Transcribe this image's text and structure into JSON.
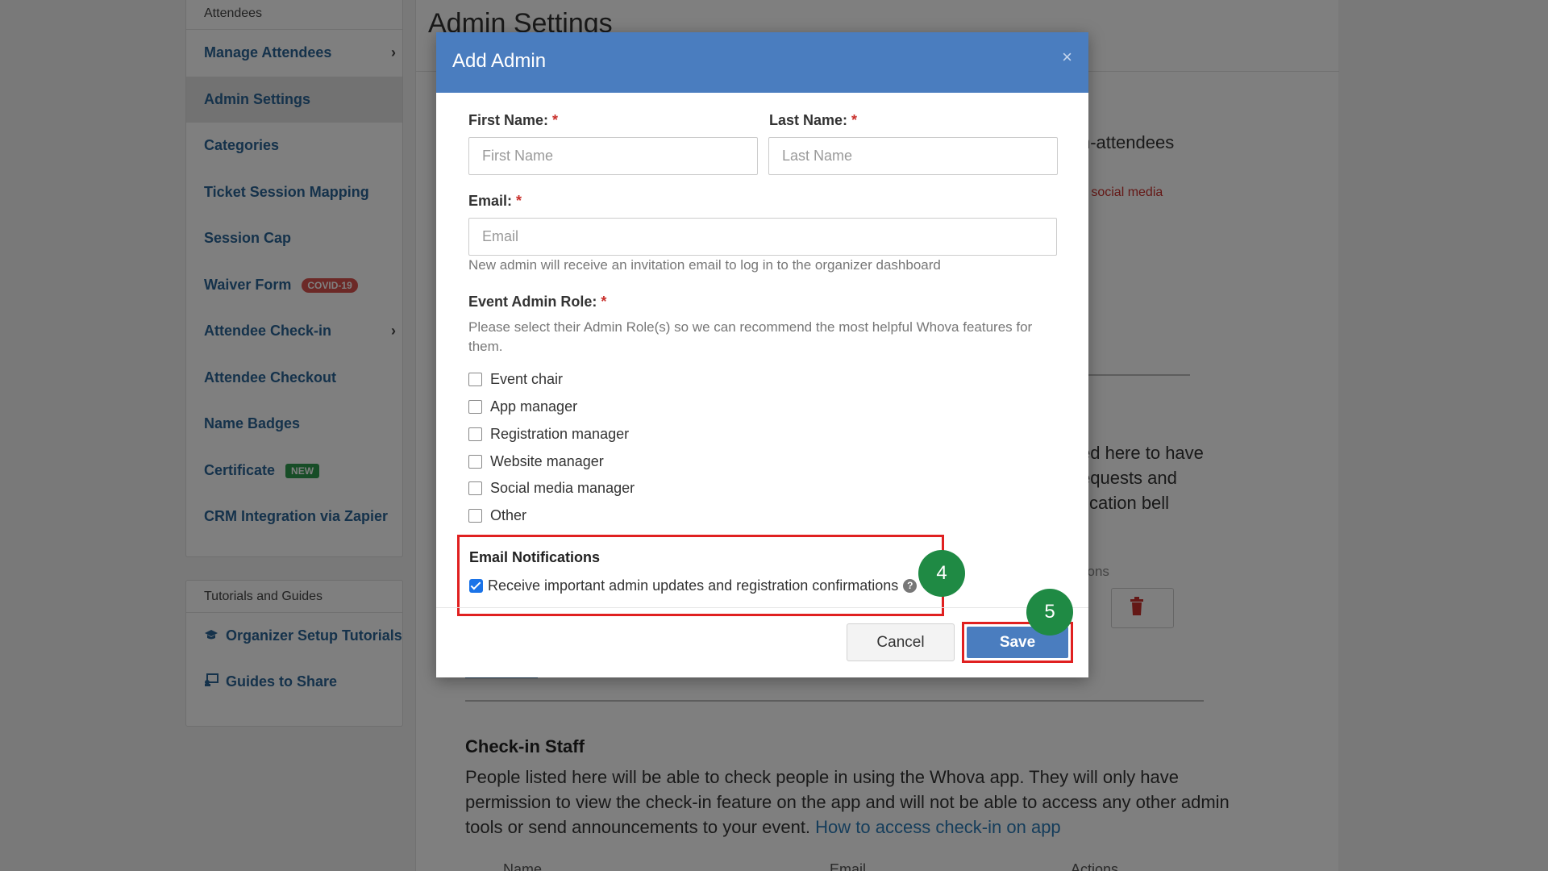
{
  "sidebar": {
    "section_heading": "Attendees",
    "items": [
      {
        "label": "Manage Attendees",
        "has_arrow": true
      },
      {
        "label": "Admin Settings",
        "active": true
      },
      {
        "label": "Categories"
      },
      {
        "label": "Ticket Session Mapping"
      },
      {
        "label": "Session Cap"
      },
      {
        "label": "Waiver Form",
        "badge": "COVID-19"
      },
      {
        "label": "Attendee Check-in",
        "has_arrow": true
      },
      {
        "label": "Attendee Checkout"
      },
      {
        "label": "Name Badges"
      },
      {
        "label": "Certificate",
        "badge": "NEW"
      },
      {
        "label": "CRM Integration via Zapier"
      }
    ],
    "tutorials": {
      "heading": "Tutorials and Guides",
      "items": [
        {
          "label": "Organizer Setup Tutorials",
          "icon": "graduation-cap-icon"
        },
        {
          "label": "Guides to Share",
          "icon": "share-guide-icon"
        }
      ]
    }
  },
  "content": {
    "page_title": "Admin Settings",
    "fragments": {
      "f1": "n-attendees",
      "f2": "n social media",
      "f3": "ed here to have",
      "f4": "equests and",
      "f5": "fication bell",
      "f6": "tions"
    },
    "checkin": {
      "title": "Check-in Staff",
      "text": "People listed here will be able to check people in using the Whova app. They will only have permission to view the check-in feature on the app and will not be able to access any other admin tools or send announcements to your event.",
      "link": "How to access check-in on app"
    },
    "table_headers": [
      "Name",
      "Email",
      "Actions"
    ]
  },
  "modal": {
    "title": "Add Admin",
    "close_glyph": "×",
    "required_mark": "*",
    "first_name": {
      "label": "First Name:",
      "placeholder": "First Name",
      "value": ""
    },
    "last_name": {
      "label": "Last Name:",
      "placeholder": "Last Name",
      "value": ""
    },
    "email": {
      "label": "Email:",
      "placeholder": "Email",
      "value": "",
      "help": "New admin will receive an invitation email to log in to the organizer dashboard"
    },
    "role": {
      "label": "Event Admin Role:",
      "help": "Please select their Admin Role(s) so we can recommend the most helpful Whova features for them.",
      "options": [
        {
          "label": "Event chair",
          "checked": false
        },
        {
          "label": "App manager",
          "checked": false
        },
        {
          "label": "Registration manager",
          "checked": false
        },
        {
          "label": "Website manager",
          "checked": false
        },
        {
          "label": "Social media manager",
          "checked": false
        },
        {
          "label": "Other",
          "checked": false
        }
      ]
    },
    "notifications": {
      "title": "Email Notifications",
      "label": "Receive important admin updates and registration confirmations",
      "checked": true,
      "help_glyph": "?"
    },
    "buttons": {
      "cancel": "Cancel",
      "save": "Save"
    }
  },
  "annotations": {
    "step4": "4",
    "step5": "5"
  },
  "colors": {
    "modal_header": "#4a7dbf",
    "sidebar_link": "#2a6496",
    "highlight_border": "#e02020",
    "step_marker": "#1f8a44",
    "checkbox_checked": "#1a73e8"
  }
}
